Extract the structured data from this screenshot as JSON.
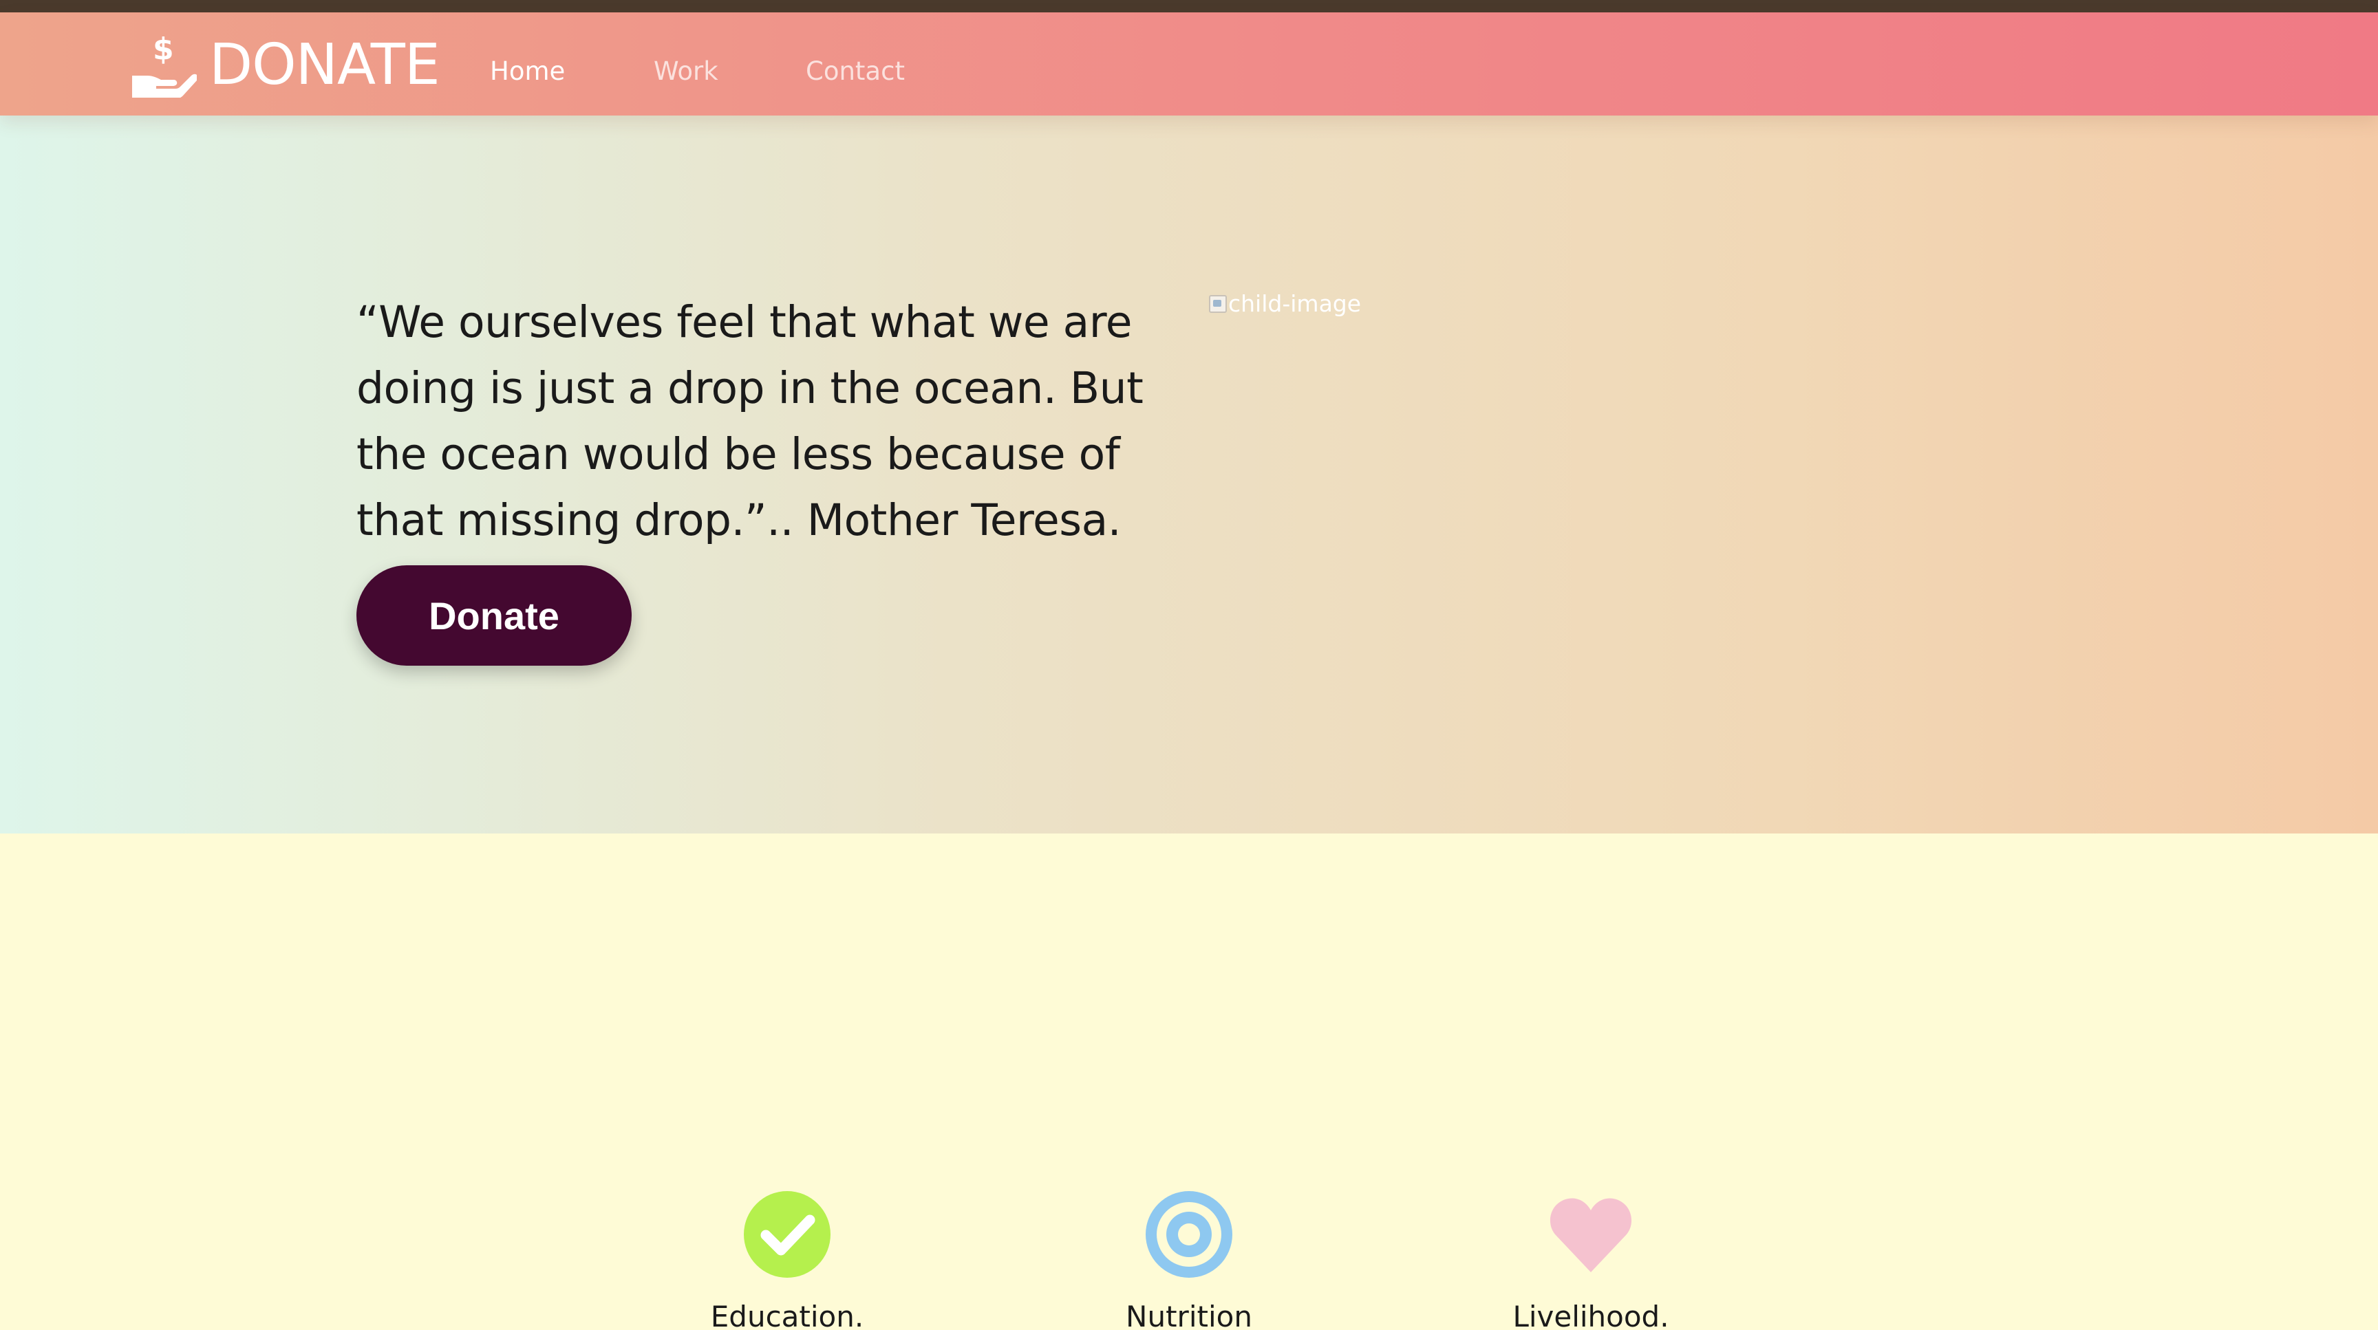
{
  "navbar": {
    "brand": "DONATE",
    "brand_icon": "hand-dollar-icon",
    "links": [
      {
        "label": "Home",
        "active": true
      },
      {
        "label": "Work",
        "active": false
      },
      {
        "label": "Contact",
        "active": false
      }
    ]
  },
  "hero": {
    "quote": "“We ourselves feel that what we are doing is just a drop in the ocean. But the ocean would be less because of that missing drop.”.. Mother Teresa.",
    "button_label": "Donate",
    "image_alt": "child-image"
  },
  "features": [
    {
      "label": "Education.",
      "icon": "check-circle-icon",
      "color": "#b5f04d"
    },
    {
      "label": "Nutrition",
      "icon": "target-icon",
      "color": "#8ec8f0"
    },
    {
      "label": "Livelihood.",
      "icon": "heart-icon",
      "color": "#f5c2cf"
    }
  ],
  "colors": {
    "top_strip": "#4a3a2c",
    "nav_gradient_start": "#eea48b",
    "nav_gradient_end": "#f07a85",
    "button": "#440830",
    "section_bg": "#fefbd6"
  }
}
